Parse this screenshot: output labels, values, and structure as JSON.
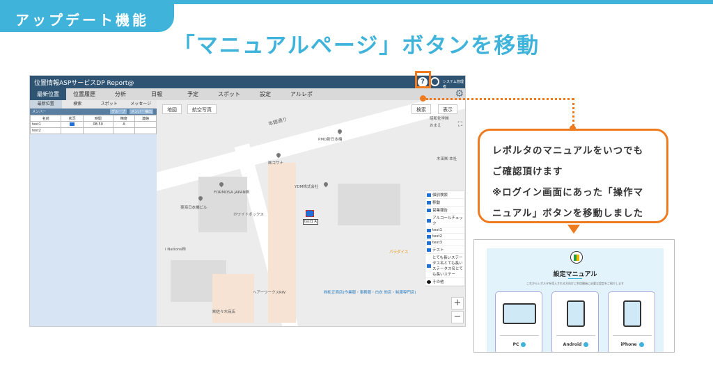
{
  "slide": {
    "tag": "アップデート機能",
    "headline": "「マニュアルページ」ボタンを移動"
  },
  "app": {
    "title": "位置情報ASPサービスDP Report@",
    "help_glyph": "?",
    "user_name": "システム管理者",
    "menu": [
      "最新位置",
      "位置履歴",
      "分析",
      "日報",
      "予定",
      "スポット",
      "設定",
      "アルレポ"
    ],
    "subtabs": [
      "最新位置",
      "検索",
      "スポット",
      "メッセージ"
    ],
    "panel": {
      "header": "メンバー",
      "group_button": "グループ",
      "export_button": "メンバー抽出",
      "columns": [
        "名前",
        "状況",
        "時間",
        "精度",
        "連絡"
      ],
      "rows": [
        {
          "name": "test1",
          "time": "08:50",
          "accuracy": "A"
        },
        {
          "name": "test2",
          "time": "",
          "accuracy": ""
        }
      ]
    },
    "map": {
      "map_button": "地図",
      "aerial_button": "航空写真",
      "search_button": "検索",
      "show_button": "表示",
      "street": "本銀通り",
      "labels": [
        "PMO新日本橋",
        "㈱コサナ",
        "YDM株式会社",
        "FORMOSA JAPAN㈱",
        "東海日本橋ビル",
        "ホワイトボックス",
        "i Nations㈱",
        "パラダイス",
        "ヘアーワークスRW",
        "㈱松正商店(作業服・事務服・白衣 他店・制服専門店)",
        "㈱佐々木商店",
        "昭和化学㈱",
        "木田㈱ 本社",
        "おまえ"
      ],
      "car_label": "test1 A",
      "legend": [
        "個別検索",
        "移動",
        "営業報告",
        "アルコールチェック",
        "test1",
        "test2",
        "test3",
        "テスト",
        "とても長いステータス名とても長いステータス名とても長いステー",
        "その他"
      ],
      "zoom_in": "+",
      "zoom_out": "−"
    }
  },
  "callout": {
    "lines": [
      "レポルタのマニュアルをいつでも",
      "ご確認頂けます",
      "※ログイン画面にあった「操作マ",
      "ニュアル」ボタンを移動しました"
    ]
  },
  "manual": {
    "title": "設定マニュアル",
    "desc": "これからレポルタを導入される方向けに利用開始に必要な設定をご紹介します",
    "cards": [
      "PC",
      "Android",
      "iPhone"
    ]
  },
  "colors": {
    "accent": "#3fb3d9",
    "callout": "#f07b1f",
    "titlebar": "#2f5473"
  }
}
